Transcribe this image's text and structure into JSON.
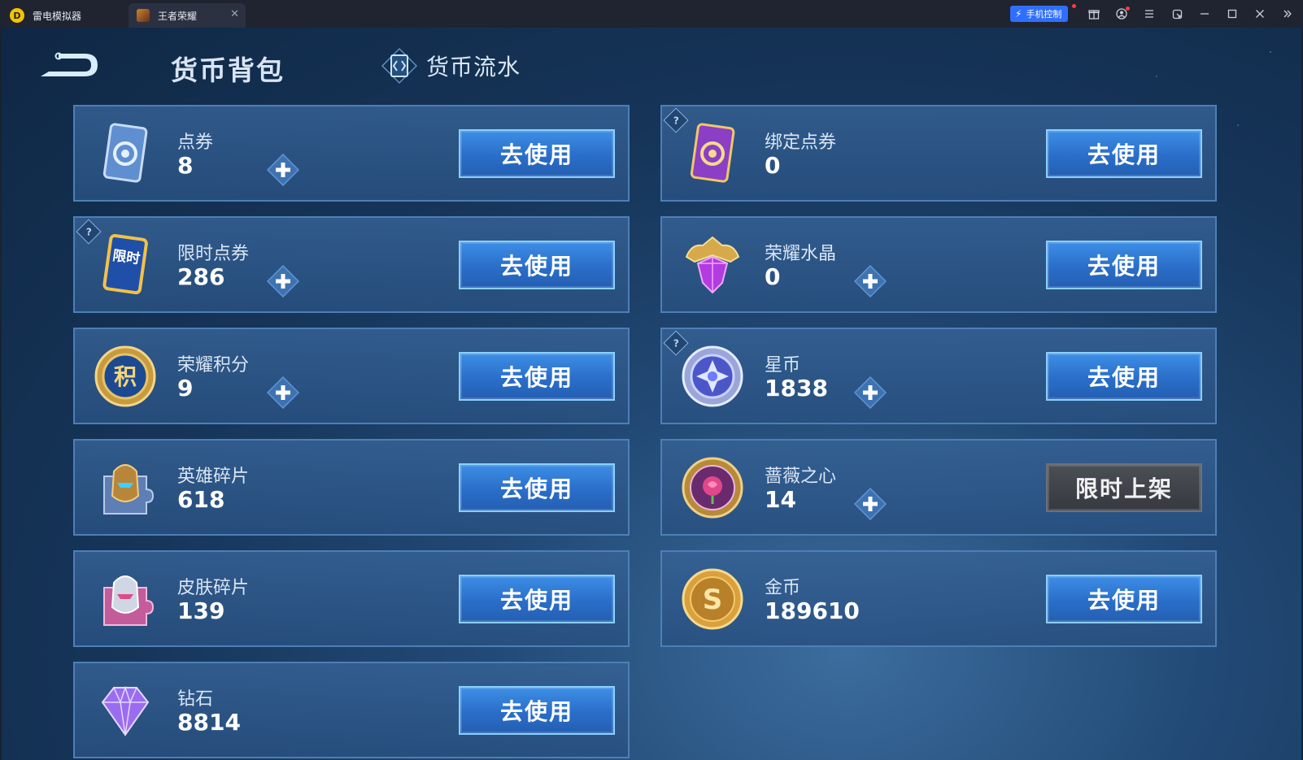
{
  "emulator": {
    "app_tab": "雷电模拟器",
    "app_logo": "D",
    "game_tab": "王者荣耀",
    "close_glyph": "✕",
    "phone_control": "手机控制",
    "accent": "#2f6fff"
  },
  "header": {
    "title": "货币背包",
    "history_label": "货币流水"
  },
  "currencies": [
    {
      "name": "点券",
      "amount": "8",
      "icon": "voucher-card-icon",
      "help": false,
      "plus": true,
      "button": "去使用",
      "button_style": "blue"
    },
    {
      "name": "绑定点券",
      "amount": "0",
      "icon": "bound-voucher-card-icon",
      "help": true,
      "plus": false,
      "button": "去使用",
      "button_style": "blue"
    },
    {
      "name": "限时点券",
      "amount": "286",
      "icon": "limited-voucher-card-icon",
      "icon_text": "限时",
      "help": true,
      "plus": true,
      "button": "去使用",
      "button_style": "blue"
    },
    {
      "name": "荣耀水晶",
      "amount": "0",
      "icon": "glory-crystal-icon",
      "help": false,
      "plus": true,
      "button": "去使用",
      "button_style": "blue"
    },
    {
      "name": "荣耀积分",
      "amount": "9",
      "icon": "glory-points-coin-icon",
      "icon_text": "积",
      "help": false,
      "plus": true,
      "button": "去使用",
      "button_style": "blue"
    },
    {
      "name": "星币",
      "amount": "1838",
      "icon": "star-coin-icon",
      "help": true,
      "plus": true,
      "button": "去使用",
      "button_style": "blue"
    },
    {
      "name": "英雄碎片",
      "amount": "618",
      "icon": "hero-fragment-icon",
      "help": false,
      "plus": false,
      "button": "去使用",
      "button_style": "blue"
    },
    {
      "name": "蔷薇之心",
      "amount": "14",
      "icon": "rose-heart-coin-icon",
      "help": false,
      "plus": true,
      "button": "限时上架",
      "button_style": "gray"
    },
    {
      "name": "皮肤碎片",
      "amount": "139",
      "icon": "skin-fragment-icon",
      "help": false,
      "plus": false,
      "button": "去使用",
      "button_style": "blue"
    },
    {
      "name": "金币",
      "amount": "189610",
      "icon": "gold-coin-icon",
      "icon_text": "S",
      "help": false,
      "plus": false,
      "button": "去使用",
      "button_style": "blue"
    },
    {
      "name": "钻石",
      "amount": "8814",
      "icon": "diamond-icon",
      "help": false,
      "plus": false,
      "button": "去使用",
      "button_style": "blue"
    }
  ]
}
